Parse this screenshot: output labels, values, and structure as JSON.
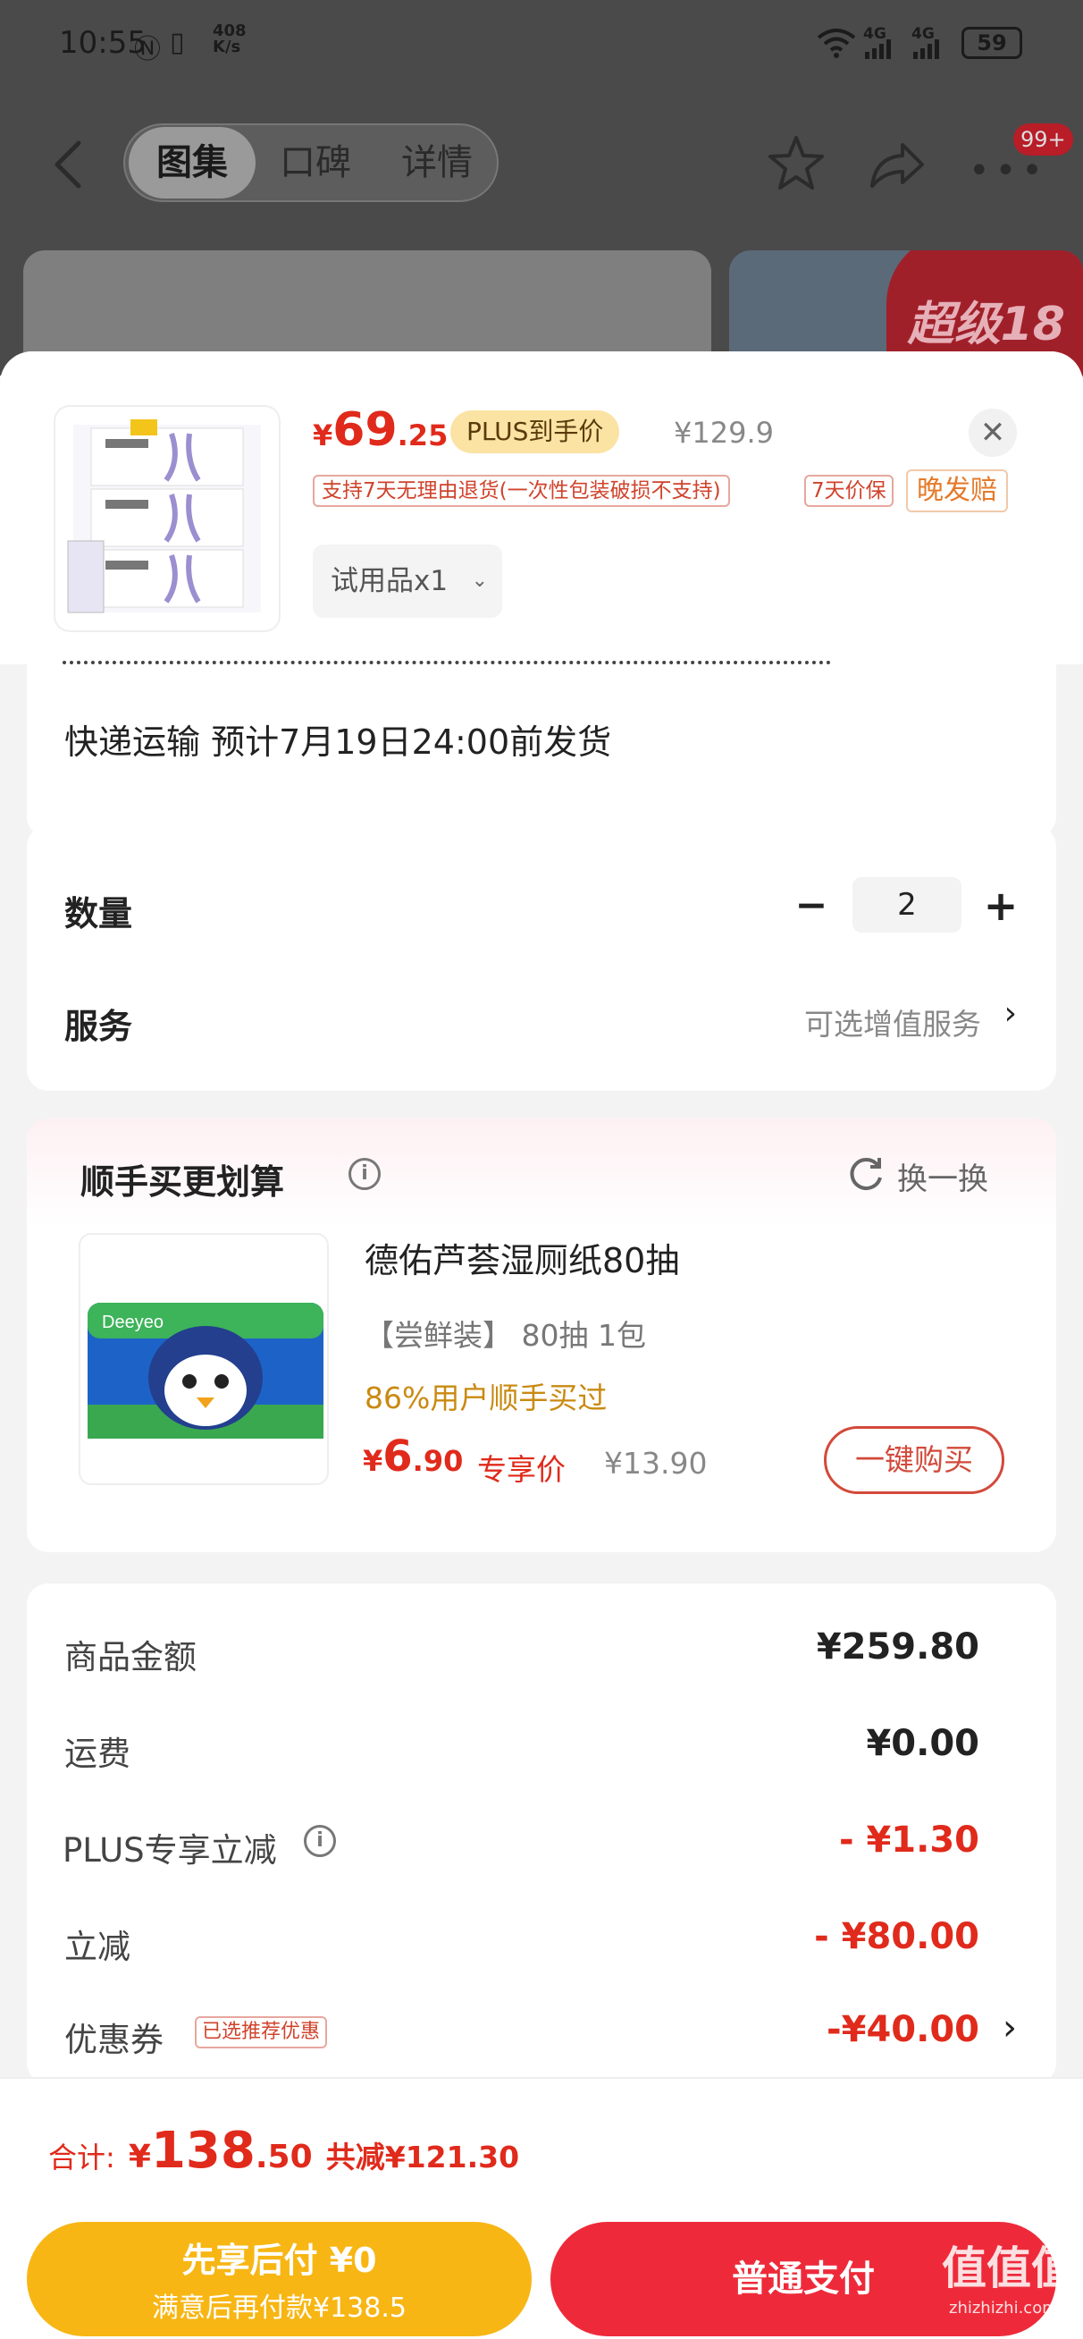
{
  "status_bar": {
    "time": "10:55",
    "net_speed_top": "408",
    "net_speed_unit": "K/s",
    "signal_1": "4G",
    "signal_2": "4G",
    "battery": "59"
  },
  "top_nav": {
    "tabs": [
      "图集",
      "口碑",
      "详情"
    ],
    "active_tab": 0,
    "badge": "99+"
  },
  "banner_text": "超级18",
  "sku_header": {
    "price_symbol": "¥",
    "price_int": "69",
    "price_dec": ".25",
    "plus_label": "PLUS到手价",
    "original_price": "¥129.9",
    "tags": [
      "支持7天无理由退货(一次性包装破损不支持)",
      "7天价保",
      "晚发赔"
    ],
    "variant": "试用品x1"
  },
  "shipping": {
    "line": "快递运输  预计7月19日24:00前发货"
  },
  "quantity_section": {
    "qty_label": "数量",
    "qty_value": "2",
    "minus": "−",
    "plus": "+",
    "service_label": "服务",
    "service_value": "可选增值服务"
  },
  "addon": {
    "title": "顺手买更划算",
    "refresh_label": "换一换",
    "product_name": "德佑芦荟湿厕纸80抽",
    "spec": "【尝鲜装】 80抽  1包",
    "social_proof": "86%用户顺手买过",
    "price_symbol": "¥",
    "price_int": "6",
    "price_dec": ".90",
    "exclusive_label": "专享价",
    "original_price": "¥13.90",
    "buy_button": "一键购买"
  },
  "summary": {
    "rows": [
      {
        "label": "商品金额",
        "value": "¥259.80"
      },
      {
        "label": "运费",
        "value": "¥0.00"
      },
      {
        "label": "PLUS专享立减",
        "value": "- ¥1.30"
      },
      {
        "label": "立减",
        "value": "- ¥80.00"
      },
      {
        "label": "优惠券",
        "value": "-¥40.00",
        "tag": "已选推荐优惠"
      }
    ]
  },
  "footer": {
    "total_label": "合计:",
    "total_symbol": "¥",
    "total_int": "138",
    "total_dec": ".50",
    "saved": "共减¥121.30",
    "pay_later_title": "先享后付 ¥0",
    "pay_later_sub": "满意后再付款¥138.5",
    "pay_normal": "普通支付"
  },
  "watermark": "值值值",
  "watermark_url": "zhizhizhi.com",
  "colors": {
    "accent_red": "#e02a1b",
    "plus_gold": "#fbe3a4",
    "pay_later_yellow": "#f7b614",
    "pay_normal_red": "#ee2a3a"
  }
}
